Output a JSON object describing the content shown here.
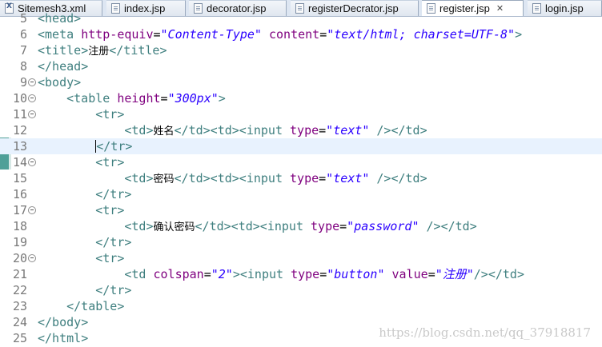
{
  "tabs": [
    {
      "label": "Sitemesh3.xml",
      "icon": "xml-file-icon",
      "active": false
    },
    {
      "label": "index.jsp",
      "icon": "jsp-file-icon",
      "active": false
    },
    {
      "label": "decorator.jsp",
      "icon": "jsp-file-icon",
      "active": false
    },
    {
      "label": "registerDecrator.jsp",
      "icon": "jsp-file-icon",
      "active": false
    },
    {
      "label": "register.jsp",
      "icon": "jsp-file-icon",
      "active": true,
      "close": "✕"
    },
    {
      "label": "login.jsp",
      "icon": "jsp-file-icon",
      "active": false
    }
  ],
  "editor": {
    "cursor_line": 13,
    "lines": [
      {
        "n": "5",
        "fold": false,
        "code": "<head>"
      },
      {
        "n": "6",
        "fold": false,
        "code": "<meta http-equiv=\"Content-Type\" content=\"text/html; charset=UTF-8\">"
      },
      {
        "n": "7",
        "fold": false,
        "code": "<title>注册</title>"
      },
      {
        "n": "8",
        "fold": false,
        "code": "</head>"
      },
      {
        "n": "9",
        "fold": true,
        "code": "<body>"
      },
      {
        "n": "10",
        "fold": true,
        "code": "    <table height=\"300px\">"
      },
      {
        "n": "11",
        "fold": true,
        "code": "        <tr>"
      },
      {
        "n": "12",
        "fold": false,
        "code": "            <td>姓名</td><td><input type=\"text\" /></td>"
      },
      {
        "n": "13",
        "fold": false,
        "code": "        </tr>"
      },
      {
        "n": "14",
        "fold": true,
        "code": "        <tr>"
      },
      {
        "n": "15",
        "fold": false,
        "code": "            <td>密码</td><td><input type=\"text\" /></td>"
      },
      {
        "n": "16",
        "fold": false,
        "code": "        </tr>"
      },
      {
        "n": "17",
        "fold": true,
        "code": "        <tr>"
      },
      {
        "n": "18",
        "fold": false,
        "code": "            <td>确认密码</td><td><input type=\"password\" /></td>"
      },
      {
        "n": "19",
        "fold": false,
        "code": "        </tr>"
      },
      {
        "n": "20",
        "fold": true,
        "code": "        <tr>"
      },
      {
        "n": "21",
        "fold": false,
        "code": "            <td colspan=\"2\"><input type=\"button\" value=\"注册\"/></td>"
      },
      {
        "n": "22",
        "fold": false,
        "code": "        </tr>"
      },
      {
        "n": "23",
        "fold": false,
        "code": "    </table>"
      },
      {
        "n": "24",
        "fold": false,
        "code": "</body>"
      },
      {
        "n": "25",
        "fold": false,
        "code": "</html>"
      }
    ]
  },
  "watermark": "https://blog.csdn.net/qq_37918817",
  "colors": {
    "tag": "#3f7f7f",
    "attr": "#7f007f",
    "value": "#2a00ff",
    "line_highlight": "#e8f2fe",
    "change_marker": "#4fa098"
  }
}
